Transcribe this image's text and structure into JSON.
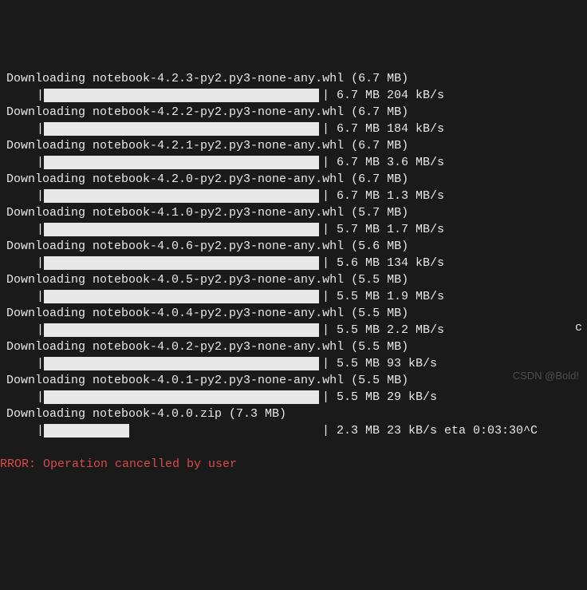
{
  "downloads": [
    {
      "line": "Downloading notebook-4.2.3-py2.py3-none-any.whl (6.7 MB)",
      "progress_pct": 100,
      "stats": "| 6.7 MB 204 kB/s"
    },
    {
      "line": "Downloading notebook-4.2.2-py2.py3-none-any.whl (6.7 MB)",
      "progress_pct": 100,
      "stats": "| 6.7 MB 184 kB/s"
    },
    {
      "line": "Downloading notebook-4.2.1-py2.py3-none-any.whl (6.7 MB)",
      "progress_pct": 100,
      "stats": "| 6.7 MB 3.6 MB/s"
    },
    {
      "line": "Downloading notebook-4.2.0-py2.py3-none-any.whl (6.7 MB)",
      "progress_pct": 100,
      "stats": "| 6.7 MB 1.3 MB/s"
    },
    {
      "line": "Downloading notebook-4.1.0-py2.py3-none-any.whl (5.7 MB)",
      "progress_pct": 100,
      "stats": "| 5.7 MB 1.7 MB/s"
    },
    {
      "line": "Downloading notebook-4.0.6-py2.py3-none-any.whl (5.6 MB)",
      "progress_pct": 100,
      "stats": "| 5.6 MB 134 kB/s"
    },
    {
      "line": "Downloading notebook-4.0.5-py2.py3-none-any.whl (5.5 MB)",
      "progress_pct": 100,
      "stats": "| 5.5 MB 1.9 MB/s"
    },
    {
      "line": "Downloading notebook-4.0.4-py2.py3-none-any.whl (5.5 MB)",
      "progress_pct": 100,
      "stats": "| 5.5 MB 2.2 MB/s"
    },
    {
      "line": "Downloading notebook-4.0.2-py2.py3-none-any.whl (5.5 MB)",
      "progress_pct": 100,
      "stats": "| 5.5 MB 93 kB/s"
    },
    {
      "line": "Downloading notebook-4.0.1-py2.py3-none-any.whl (5.5 MB)",
      "progress_pct": 100,
      "stats": "| 5.5 MB 29 kB/s"
    },
    {
      "line": "Downloading notebook-4.0.0.zip (7.3 MB)",
      "progress_pct": 31,
      "stats": "| 2.3 MB 23 kB/s eta 0:03:30^C"
    }
  ],
  "stray_char": "c",
  "error_line": "RROR: Operation cancelled by user",
  "watermark": "CSDN @Bold!"
}
